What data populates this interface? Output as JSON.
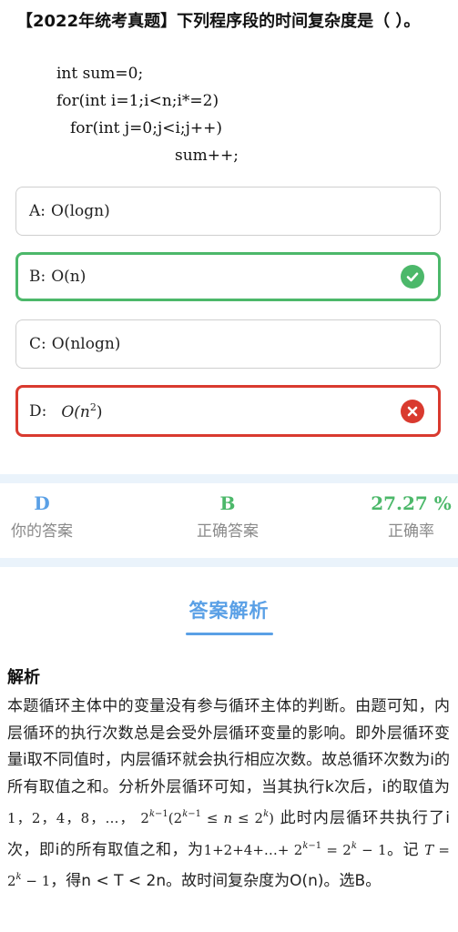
{
  "question": {
    "title": "【2022年统考真题】下列程序段的时间复杂度是（ ）。",
    "code_lines": [
      "int sum=0;",
      "for(int i=1;i<n;i*=2)",
      "for(int j=0;j<i;j++)",
      "sum++;"
    ]
  },
  "options": [
    {
      "prefix": "A:",
      "text": "O(logn)",
      "state": "normal"
    },
    {
      "prefix": "B:",
      "text": "O(n)",
      "state": "correct"
    },
    {
      "prefix": "C:",
      "text": "O(nlogn)",
      "state": "normal"
    },
    {
      "prefix": "D:",
      "text_base": "O(n",
      "text_sup": "2",
      "text_end": ")",
      "state": "wrong"
    }
  ],
  "stats": {
    "your_answer": {
      "value": "D",
      "label": "你的答案"
    },
    "correct_answer": {
      "value": "B",
      "label": "正确答案"
    },
    "accuracy": {
      "value": "27.27 %",
      "label": "正确率"
    }
  },
  "analysis": {
    "heading": "答案解析",
    "label": "解析",
    "p1": "本题循环主体中的变量没有参与循环主体的判断。由题可知，内层循环的执行次数总是会受外层循环变量的影响。即外层循环变量i取不同值时，内层循环就会执行相应次数。故总循环次数为i的所有取值之和。分析外层循环可知，当其执行k次后，i的取值为",
    "seq": "1，2，4，8，…，",
    "p2": "此时内层循环共执行了i次，即i的所有取值之和，为",
    "sum_seq": "1+2+4+…+",
    "p3": "。记",
    "p4": "，得n < T < 2n。故时间复杂度为O(n)。选B。"
  },
  "colors": {
    "correct": "#4cb86a",
    "wrong": "#d93a2f",
    "accent": "#5aa0e6",
    "band": "#eaf3fb"
  },
  "icons": {
    "correct_icon": "check-circle-icon",
    "wrong_icon": "x-circle-icon"
  }
}
